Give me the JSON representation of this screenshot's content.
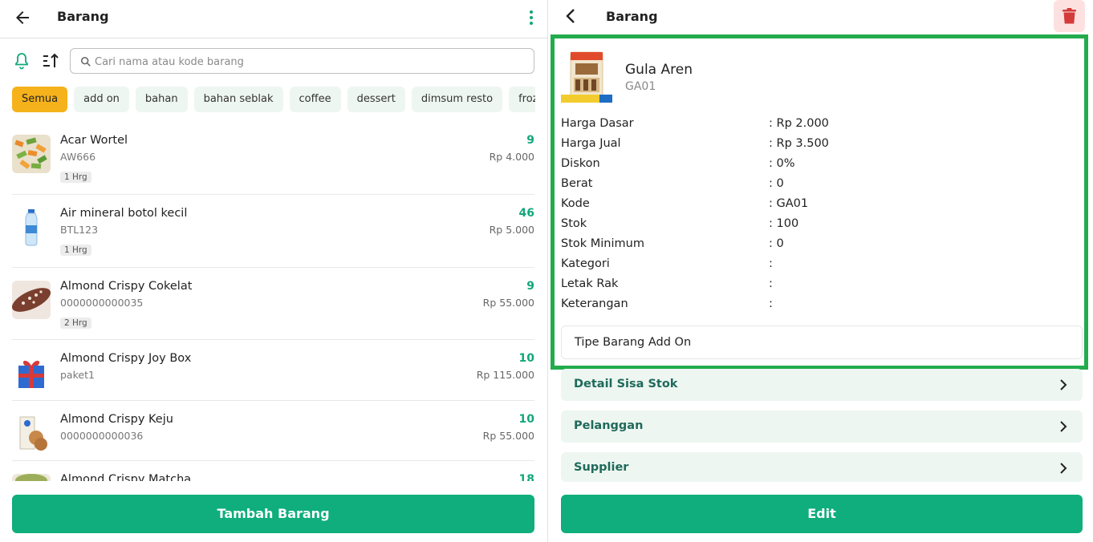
{
  "left": {
    "title": "Barang",
    "search_placeholder": "Cari nama atau kode barang",
    "categories": [
      "Semua",
      "add on",
      "bahan",
      "bahan seblak",
      "coffee",
      "dessert",
      "dimsum resto",
      "frozen"
    ],
    "items": [
      {
        "name": "Acar Wortel",
        "code": "AW666",
        "qty": "9",
        "price": "Rp 4.000",
        "badge": "1 Hrg"
      },
      {
        "name": "Air mineral botol kecil",
        "code": "BTL123",
        "qty": "46",
        "price": "Rp 5.000",
        "badge": "1 Hrg"
      },
      {
        "name": "Almond Crispy Cokelat",
        "code": "0000000000035",
        "qty": "9",
        "price": "Rp 55.000",
        "badge": "2 Hrg"
      },
      {
        "name": "Almond Crispy Joy Box",
        "code": "paket1",
        "qty": "10",
        "price": "Rp 115.000",
        "badge": ""
      },
      {
        "name": "Almond Crispy Keju",
        "code": "0000000000036",
        "qty": "10",
        "price": "Rp 55.000",
        "badge": ""
      },
      {
        "name": "Almond Crispy Matcha",
        "code": "",
        "qty": "18",
        "price": "",
        "badge": ""
      }
    ],
    "add_button": "Tambah Barang"
  },
  "right": {
    "title": "Barang",
    "product": {
      "name": "Gula Aren",
      "code": "GA01"
    },
    "details": [
      {
        "label": "Harga Dasar",
        "value": ": Rp 2.000"
      },
      {
        "label": "Harga Jual",
        "value": ": Rp 3.500"
      },
      {
        "label": "Diskon",
        "value": ": 0%"
      },
      {
        "label": "Berat",
        "value": ": 0"
      },
      {
        "label": "Kode",
        "value": ": GA01"
      },
      {
        "label": "Stok",
        "value": ": 100"
      },
      {
        "label": "Stok Minimum",
        "value": ": 0"
      },
      {
        "label": "Kategori",
        "value": ":"
      },
      {
        "label": "Letak Rak",
        "value": ":"
      },
      {
        "label": "Keterangan",
        "value": ":"
      }
    ],
    "addon_type": "Tipe Barang Add On",
    "nav": [
      "Detail Sisa Stok",
      "Pelanggan",
      "Supplier"
    ],
    "edit_button": "Edit"
  },
  "colors": {
    "accent": "#0fae7c",
    "chip_active": "#f6b21b",
    "highlight": "#22ac4e",
    "delete_bg": "#fde1e1",
    "delete_icon": "#d43b3b"
  }
}
